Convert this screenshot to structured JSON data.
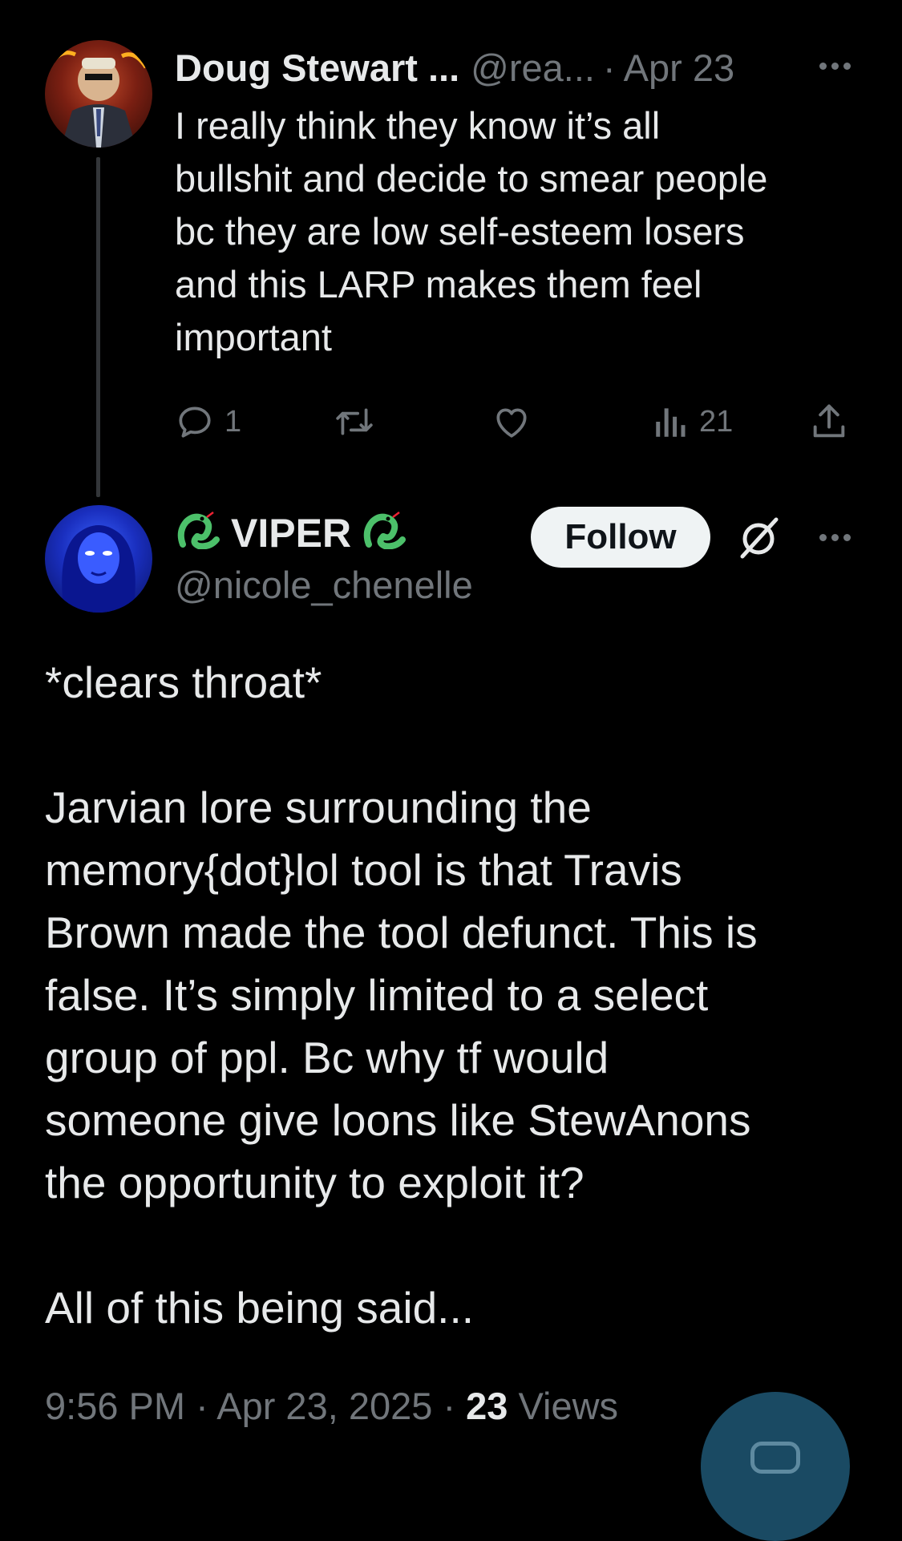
{
  "reply_tweet": {
    "author_name": "Doug Stewart ...",
    "author_handle": "@rea...",
    "separator": "·",
    "date": "Apr 23",
    "text_lines": [
      "I really think they know it’s all",
      "bullshit and decide to smear people",
      "bc they are low self-esteem losers",
      "and this LARP makes them feel",
      "important"
    ],
    "actions": {
      "reply_count": "1",
      "retweet_count": "",
      "like_count": "",
      "views_count": "21"
    }
  },
  "main_tweet": {
    "author_name": "VIPER",
    "name_emoji_left": "snake-emoji",
    "name_emoji_right": "snake-emoji",
    "author_handle": "@nicole_chenelle",
    "follow_label": "Follow",
    "paragraphs": [
      [
        "*clears throat*"
      ],
      [
        "Jarvian lore surrounding the",
        "memory{dot}lol tool is that Travis",
        "Brown made the tool defunct. This is",
        "false. It’s simply limited to a select",
        "group of ppl. Bc why tf would",
        "someone give loons like StewAnons",
        "the opportunity to exploit it?"
      ],
      [
        "All of this being said..."
      ]
    ],
    "time": "9:56 PM",
    "separator": "·",
    "date": "Apr 23, 2025",
    "views_count": "23",
    "views_label": "Views"
  },
  "colors": {
    "background": "#000000",
    "text_primary": "#e7e9ea",
    "text_secondary": "#71767b",
    "follow_bg": "#eff3f4",
    "snake_green": "#4cc06a",
    "fab_bg": "#1a4a63"
  }
}
